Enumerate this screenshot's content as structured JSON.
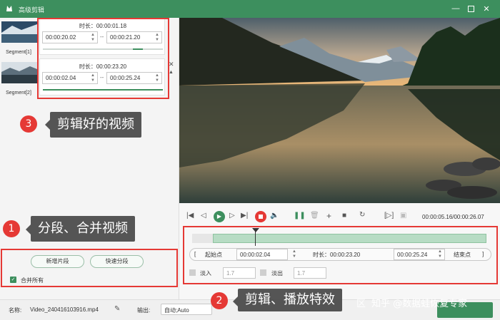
{
  "window": {
    "title": "高级剪辑"
  },
  "segments": [
    {
      "label": "Segment[1]",
      "duration": "时长：00:00:01.18",
      "start": "00:00:20.02",
      "end": "00:00:21.20"
    },
    {
      "label": "Segment[2]",
      "duration": "时长：00:00:23.20",
      "start": "00:00:02.04",
      "end": "00:00:25.24"
    }
  ],
  "segment_separator": "--",
  "callouts": [
    {
      "num": "3",
      "text": "剪辑好的视频"
    },
    {
      "num": "1",
      "text": "分段、合并视频"
    },
    {
      "num": "2",
      "text": "剪辑、播放特效"
    }
  ],
  "left_buttons": {
    "new_segment": "新增片段",
    "quick_split": "快速分段",
    "merge_all": "合并所有",
    "merge_checked": true
  },
  "player": {
    "time_readout": "00:00:05.16/00:00:26.07"
  },
  "trim": {
    "start_btn": "起始点",
    "start_value": "00:00:02.04",
    "duration_label": "时长：00:00:23.20",
    "end_value": "00:00:25.24",
    "end_btn": "结束点",
    "bracket_left": "[",
    "bracket_right": "]"
  },
  "fades": {
    "fade_in_label": "淡入",
    "fade_in_value": "1.7",
    "fade_out_label": "淡出",
    "fade_out_value": "1.7"
  },
  "bottom": {
    "name_label": "名称:",
    "file_name": "Video_240416103916.mp4",
    "output_label": "输出:",
    "output_value": "自动;Auto"
  },
  "watermark": "知乎 @数据蛙恢复专家",
  "watermark_partial": "区",
  "colors": {
    "accent": "#3d8f5e",
    "callout": "#e53935"
  }
}
